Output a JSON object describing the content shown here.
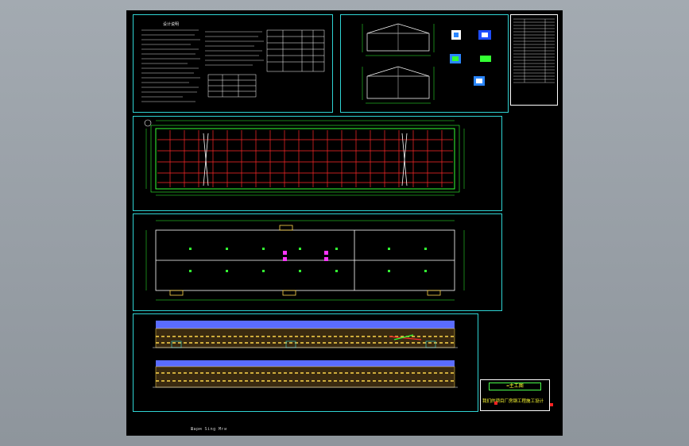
{
  "viewer": {
    "background_color": "#9aa1a8",
    "sheet_color": "#000000",
    "frame_color": "#2fd3d3"
  },
  "drawing": {
    "notes_heading": "设计说明",
    "footer_text": "Шарм Sing Мги",
    "stamp_title": "=主工图",
    "stamp_subtitle": "我们的项目厂房钢工程施工设计"
  },
  "colors": {
    "grid_red": "#ff2a2a",
    "wall_green": "#33ff33",
    "text_white": "#e8e8e8",
    "accent_magenta": "#ff33ff",
    "facade_yellow": "#ffd84a",
    "roof_blue": "#5a6cff"
  }
}
